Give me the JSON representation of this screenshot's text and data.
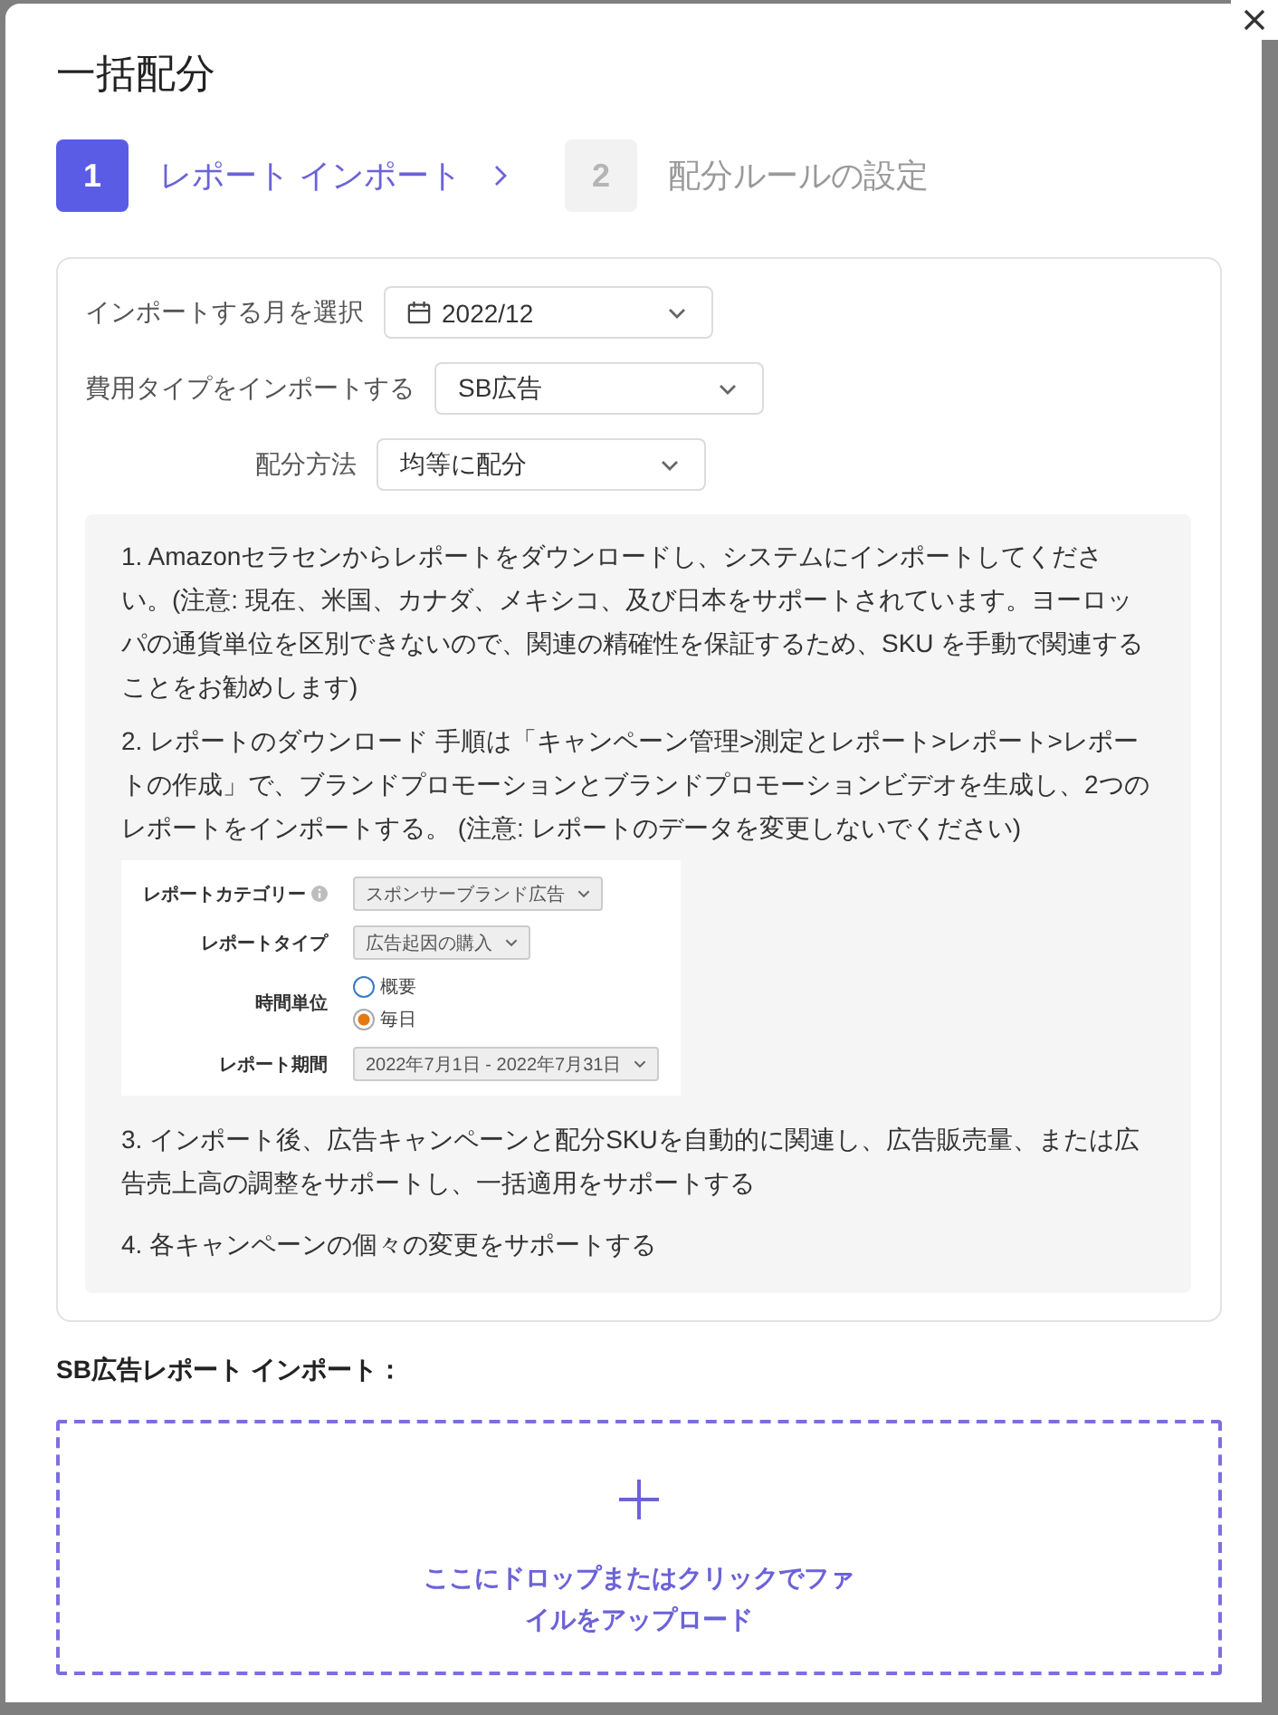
{
  "dialog": {
    "title": "一括配分"
  },
  "steps": [
    {
      "number": "1",
      "label": "レポート インポート",
      "selected": true
    },
    {
      "number": "2",
      "label": "配分ルールの設定",
      "selected": false
    }
  ],
  "form": [
    {
      "kind": "month",
      "label": "インポートする月を選択",
      "value": "2022/12"
    },
    {
      "kind": "select",
      "label": "費用タイプをインポートする",
      "value": "SB広告"
    },
    {
      "kind": "select",
      "label": "配分方法",
      "value": "均等に配分"
    }
  ],
  "instructions": [
    {
      "kind": "text",
      "text": "1. Amazonセラセンからレポートをダウンロードし、システムにインポートしてください。(注意: 現在、米国、カナダ、メキシコ、及び日本をサポートされています。ヨーロッパの通貨単位を区別できないので、関連の精確性を保証するため、SKU を手動で関連することをお勧めします)"
    },
    {
      "kind": "text",
      "text": "2. レポートのダウンロード 手順は「キャンペーン管理>測定とレポート>レポート>レポートの作成」で、ブランドプロモーションとブランドプロモーションビデオを生成し、2つのレポートをインポートする。 (注意: レポートのデータを変更しないでください)"
    },
    {
      "kind": "screenshot",
      "rows": [
        {
          "kind": "select",
          "label": "レポートカテゴリー",
          "info": true,
          "value": "スポンサーブランド広告"
        },
        {
          "kind": "select",
          "label": "レポートタイプ",
          "info": false,
          "value": "広告起因の購入"
        },
        {
          "kind": "radio",
          "label": "時間単位",
          "info": false,
          "options": [
            {
              "label": "概要",
              "selected": false
            },
            {
              "label": "毎日",
              "selected": true
            }
          ]
        },
        {
          "kind": "select",
          "label": "レポート期間",
          "info": false,
          "value": "2022年7月1日 - 2022年7月31日"
        }
      ]
    },
    {
      "kind": "text",
      "text": "3. インポート後、広告キャンペーンと配分SKUを自動的に関連し、広告販売量、または広告売上高の調整をサポートし、一括適用をサポートする"
    },
    {
      "kind": "text",
      "text": "4. 各キャンペーンの個々の変更をサポートする"
    }
  ],
  "upload": {
    "heading": "SB広告レポート インポート：",
    "prompt": "ここにドロップまたはクリックでファイルをアップロード"
  }
}
